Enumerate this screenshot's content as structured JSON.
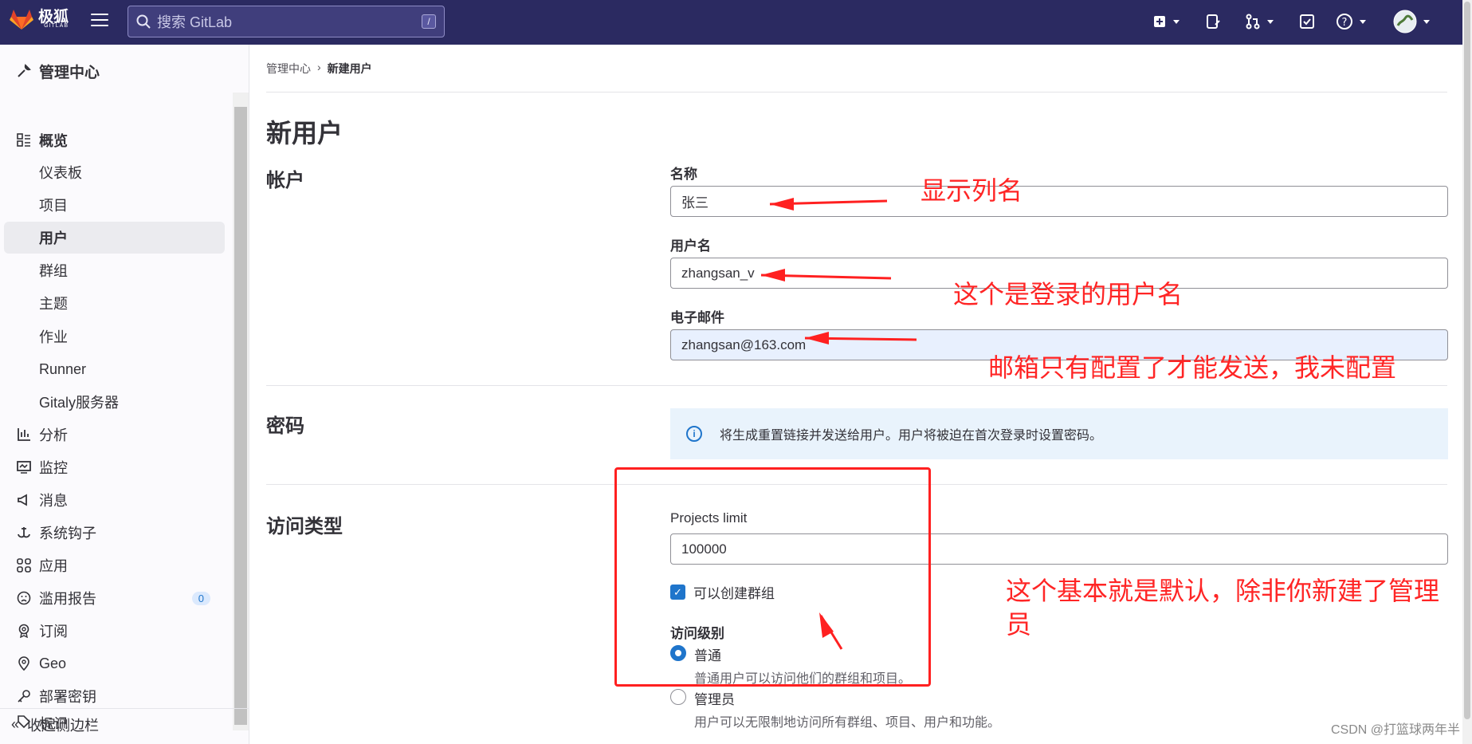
{
  "topbar": {
    "brand": "极狐",
    "brand_sub": "GITLAB",
    "search_placeholder": "搜索 GitLab",
    "search_shortcut": "/"
  },
  "sidebar": {
    "header": "管理中心",
    "items": [
      {
        "label": "概览",
        "icon": "overview-icon",
        "head": true
      },
      {
        "label": "仪表板"
      },
      {
        "label": "项目"
      },
      {
        "label": "用户",
        "active": true
      },
      {
        "label": "群组"
      },
      {
        "label": "主题"
      },
      {
        "label": "作业"
      },
      {
        "label": "Runner"
      },
      {
        "label": "Gitaly服务器"
      },
      {
        "label": "分析",
        "icon": "analytics-icon"
      },
      {
        "label": "监控",
        "icon": "monitor-icon"
      },
      {
        "label": "消息",
        "icon": "messages-icon"
      },
      {
        "label": "系统钩子",
        "icon": "hook-icon"
      },
      {
        "label": "应用",
        "icon": "apps-icon"
      },
      {
        "label": "滥用报告",
        "icon": "abuse-icon",
        "badge": "0"
      },
      {
        "label": "订阅",
        "icon": "subscription-icon"
      },
      {
        "label": "Geo",
        "icon": "geo-icon"
      },
      {
        "label": "部署密钥",
        "icon": "key-icon"
      },
      {
        "label": "标记",
        "icon": "label-icon"
      }
    ],
    "collapse_label": "收起侧边栏"
  },
  "breadcrumb": {
    "parent": "管理中心",
    "current": "新建用户"
  },
  "page": {
    "title": "新用户",
    "account_section": "帐户",
    "name_label": "名称",
    "name_value": "张三",
    "username_label": "用户名",
    "username_value": "zhangsan_v",
    "email_label": "电子邮件",
    "email_value": "zhangsan@163.com",
    "password_section": "密码",
    "password_info": "将生成重置链接并发送给用户。用户将被迫在首次登录时设置密码。",
    "access_section": "访问类型",
    "projects_limit_label": "Projects limit",
    "projects_limit_value": "100000",
    "can_create_group_label": "可以创建群组",
    "can_create_group_checked": true,
    "access_level_label": "访问级别",
    "access_levels": [
      {
        "label": "普通",
        "help": "普通用户可以访问他们的群组和项目。",
        "selected": true
      },
      {
        "label": "管理员",
        "help": "用户可以无限制地访问所有群组、项目、用户和功能。",
        "selected": false
      }
    ]
  },
  "annotations": {
    "note_name": "显示列名",
    "note_username": "这个是登录的用户名",
    "note_email": "邮箱只有配置了才能发送，我未配置",
    "note_access_1": "这个基本就是默认，除非你新建了管理",
    "note_access_2": "员",
    "color": "#ff2525"
  },
  "watermark": "CSDN @打篮球两年半"
}
